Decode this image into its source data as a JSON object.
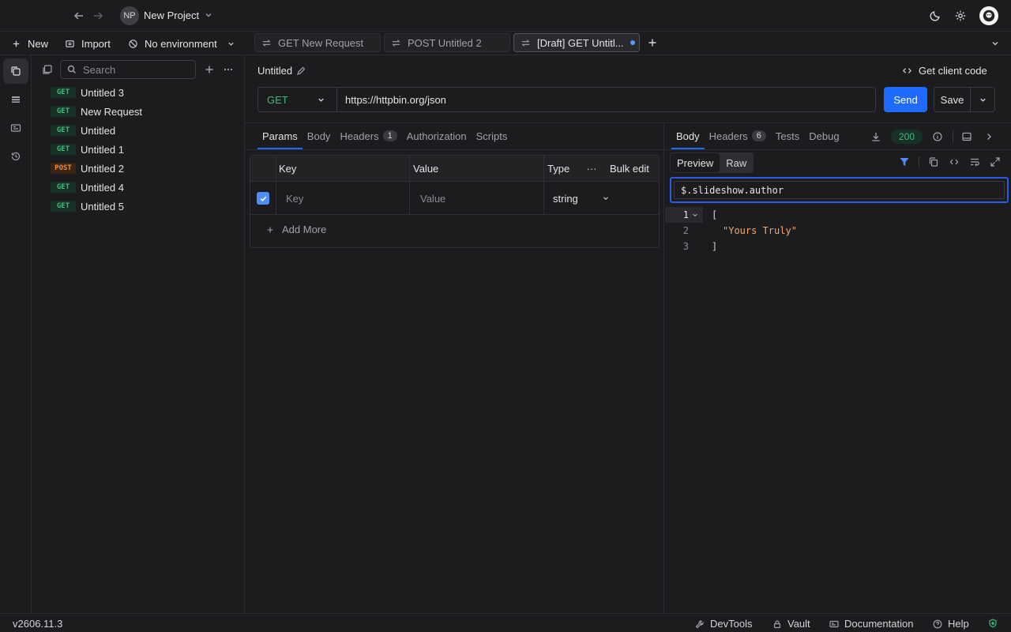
{
  "titlebar": {
    "project_initials": "NP",
    "project_name": "New Project"
  },
  "toolbar": {
    "new_label": "New",
    "import_label": "Import",
    "environment_label": "No environment"
  },
  "open_tabs": [
    {
      "label": "GET New Request"
    },
    {
      "label": "POST Untitled 2"
    },
    {
      "label": "[Draft] GET Untitl..."
    }
  ],
  "sidebar": {
    "search_placeholder": "Search",
    "requests": [
      {
        "method": "GET",
        "name": "Untitled 3"
      },
      {
        "method": "GET",
        "name": "New Request"
      },
      {
        "method": "GET",
        "name": "Untitled"
      },
      {
        "method": "GET",
        "name": "Untitled 1"
      },
      {
        "method": "POST",
        "name": "Untitled 2"
      },
      {
        "method": "GET",
        "name": "Untitled 4"
      },
      {
        "method": "GET",
        "name": "Untitled 5"
      }
    ]
  },
  "request": {
    "title": "Untitled",
    "client_code_label": "Get client code",
    "method": "GET",
    "url": "https://httpbin.org/json",
    "send_label": "Send",
    "save_label": "Save",
    "tabs": [
      {
        "label": "Params"
      },
      {
        "label": "Body"
      },
      {
        "label": "Headers",
        "count": "1"
      },
      {
        "label": "Authorization"
      },
      {
        "label": "Scripts"
      }
    ],
    "params": {
      "col_key": "Key",
      "col_value": "Value",
      "col_type": "Type",
      "bulk_edit": "Bulk edit",
      "more": "···",
      "key_placeholder": "Key",
      "value_placeholder": "Value",
      "type_value": "string",
      "add_more": "Add More"
    }
  },
  "response": {
    "tabs": [
      {
        "label": "Body"
      },
      {
        "label": "Headers",
        "count": "6"
      },
      {
        "label": "Tests"
      },
      {
        "label": "Debug"
      }
    ],
    "status_code": "200",
    "view_modes": [
      "Preview",
      "Raw"
    ],
    "filter_query": "$.slideshow.author",
    "lines": [
      {
        "n": "1",
        "text": "["
      },
      {
        "n": "2",
        "text": "\"Yours Truly\""
      },
      {
        "n": "3",
        "text": "]"
      }
    ]
  },
  "statusbar": {
    "version": "v2606.11.3",
    "devtools": "DevTools",
    "vault": "Vault",
    "documentation": "Documentation",
    "help": "Help"
  },
  "colors": {
    "accent": "#1f6bff",
    "get_method": "#3dbb7a",
    "post_method": "#f08b3b",
    "string_value": "#f0a86f"
  }
}
